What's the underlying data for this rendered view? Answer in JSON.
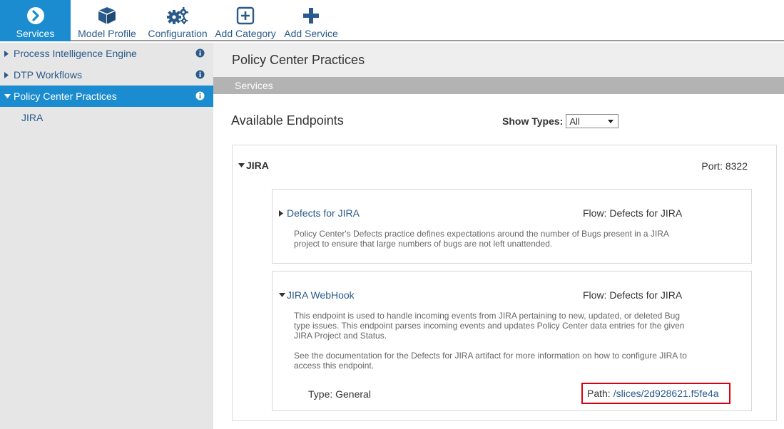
{
  "toolbar": {
    "buttons": [
      {
        "label": "Services",
        "icon": "chevron-right-circle-icon",
        "active": true
      },
      {
        "label": "Model Profile",
        "icon": "cube-icon"
      },
      {
        "label": "Configuration",
        "icon": "gears-icon"
      },
      {
        "label": "Add Category",
        "icon": "plus-square-icon"
      },
      {
        "label": "Add Service",
        "icon": "plus-icon"
      }
    ]
  },
  "sidebar": {
    "items": [
      {
        "label": "Process Intelligence Engine",
        "expanded": false
      },
      {
        "label": "DTP Workflows",
        "expanded": false
      },
      {
        "label": "Policy Center Practices",
        "expanded": true,
        "active": true
      }
    ],
    "subitems": [
      {
        "label": "JIRA"
      }
    ]
  },
  "main": {
    "title": "Policy Center Practices",
    "section_bar": "Services",
    "endpoints_title": "Available Endpoints",
    "show_types": {
      "label": "Show Types:",
      "value": "All"
    },
    "category": {
      "name": "JIRA",
      "port": "Port: 8322",
      "endpoints": [
        {
          "title": "Defects for JIRA",
          "flow": "Flow: Defects for JIRA",
          "desc1": "Policy Center's Defects practice defines expectations around the number of Bugs present in a JIRA",
          "desc2": "project to ensure that large numbers of bugs are not left unattended."
        },
        {
          "title": "JIRA WebHook",
          "flow": "Flow: Defects for JIRA",
          "desc1": "This endpoint is used to handle incoming events from JIRA pertaining to new, updated, or deleted Bug",
          "desc2": "type issues. This endpoint parses incoming events and updates Policy Center data entries for the given",
          "desc3": "JIRA Project and Status.",
          "desc4": "See the documentation for the Defects for JIRA artifact for more information on how to configure JIRA to",
          "desc5": "access this endpoint.",
          "type": "Type: General",
          "path_label": "Path:",
          "path": "/slices/2d928621.f5fe4a"
        }
      ]
    }
  },
  "colors": {
    "accent": "#1a8ccf",
    "link": "#2a5a8a",
    "highlight": "#d9000d"
  }
}
